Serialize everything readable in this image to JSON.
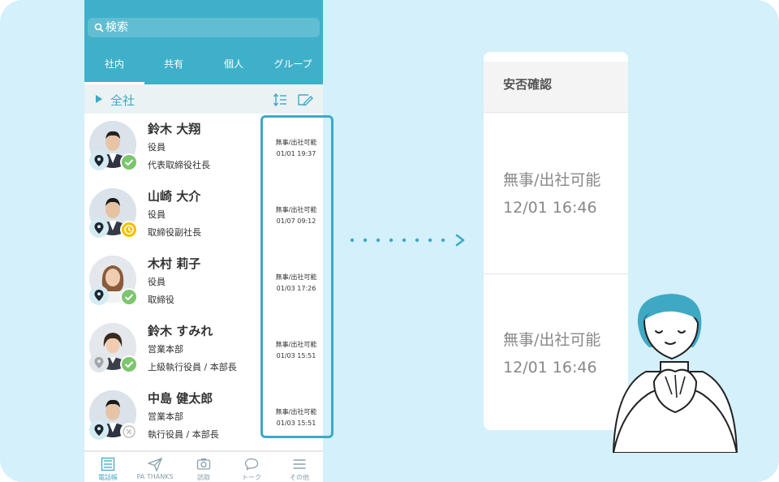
{
  "search": {
    "placeholder": "検索"
  },
  "tabs": [
    {
      "label": "社内",
      "active": true
    },
    {
      "label": "共有"
    },
    {
      "label": "個人"
    },
    {
      "label": "グループ"
    }
  ],
  "group": {
    "name": "全社"
  },
  "contacts": [
    {
      "name": "鈴木 大翔",
      "dept": "役員",
      "title": "代表取締役社長",
      "safety": "無事/出社可能",
      "time": "01/01 19:37",
      "status": "ok",
      "location_icon": "location-pin-icon"
    },
    {
      "name": "山崎 大介",
      "dept": "役員",
      "title": "取締役副社長",
      "safety": "無事/出社可能",
      "time": "01/07 09:12",
      "status": "pending",
      "location_icon": "location-pin-icon"
    },
    {
      "name": "木村 莉子",
      "dept": "役員",
      "title": "取締役",
      "safety": "無事/出社可能",
      "time": "01/03 17:26",
      "status": "ok",
      "location_icon": "location-pin-icon"
    },
    {
      "name": "鈴木 すみれ",
      "dept": "営業本部",
      "title": "上級執行役員 / 本部長",
      "safety": "無事/出社可能",
      "time": "01/03 15:51",
      "status": "ok",
      "location_icon": "location-pin-icon"
    },
    {
      "name": "中島 健太郎",
      "dept": "営業本部",
      "title": "執行役員 / 本部長",
      "safety": "無事/出社可能",
      "time": "01/03 15:51",
      "status": "unavailable",
      "location_icon": "location-pin-icon"
    }
  ],
  "bottom_nav": [
    {
      "label": "電話帳",
      "icon": "phonebook-icon",
      "active": true
    },
    {
      "label": "PA THANKS",
      "icon": "paper-plane-icon"
    },
    {
      "label": "読取",
      "icon": "camera-scan-icon"
    },
    {
      "label": "トーク",
      "icon": "chat-bubble-icon"
    },
    {
      "label": "その他",
      "icon": "menu-icon"
    }
  ],
  "card": {
    "header": "安否確認",
    "entries": [
      {
        "status": "無事/出社可能",
        "time": "12/01 16:46"
      },
      {
        "status": "無事/出社可能",
        "time": "12/01 16:46"
      }
    ]
  },
  "colors": {
    "background": "#d3f0fb",
    "header": "#3fb0c9",
    "accent": "#3fa9c4",
    "ok": "#7cc66e",
    "pending": "#f5c000",
    "unavailable": "#bdbdbd"
  }
}
